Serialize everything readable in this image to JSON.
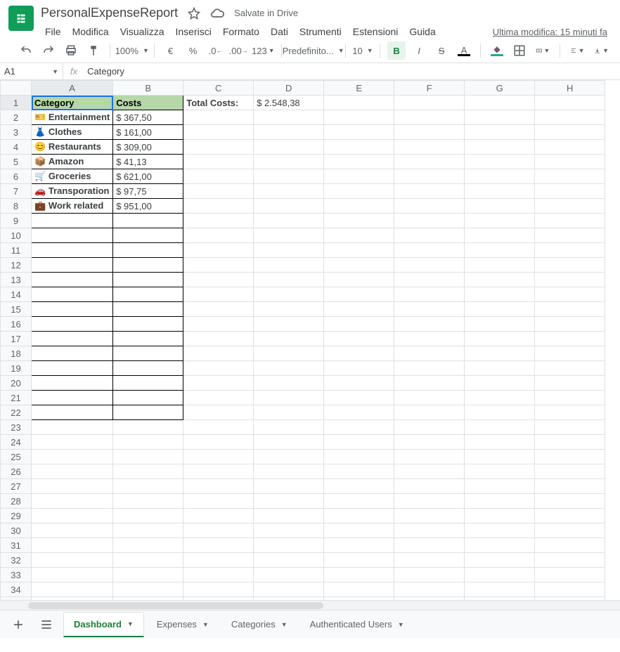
{
  "doc": {
    "title": "PersonalExpenseReport",
    "save_status": "Salvate in Drive",
    "last_edit": "Ultima modifica: 15 minuti fa"
  },
  "menus": [
    "File",
    "Modifica",
    "Visualizza",
    "Inserisci",
    "Formato",
    "Dati",
    "Strumenti",
    "Estensioni",
    "Guida"
  ],
  "toolbar": {
    "zoom": "100%",
    "currency": "€",
    "percent": "%",
    "dec_less": ".0",
    "dec_more": ".00",
    "more_formats": "123",
    "font_name": "Predefinito...",
    "font_size": "10",
    "bold": "B",
    "italic": "I",
    "strike": "S",
    "text_color": "A"
  },
  "fx": {
    "name_box": "A1",
    "formula": "Category"
  },
  "columns": [
    "A",
    "B",
    "C",
    "D",
    "E",
    "F",
    "G",
    "H"
  ],
  "row_count": 35,
  "headers": {
    "A1": "Category",
    "B1": "Costs",
    "C1": "Total Costs:",
    "D1": "$ 2.548,38"
  },
  "rows": [
    {
      "emoji": "🎫",
      "cat": "Entertainment",
      "cost": "$ 367,50"
    },
    {
      "emoji": "👗",
      "cat": "Clothes",
      "cost": "$ 161,00"
    },
    {
      "emoji": "😊",
      "cat": "Restaurants",
      "cost": "$ 309,00"
    },
    {
      "emoji": "📦",
      "cat": "Amazon",
      "cost": "$ 41,13"
    },
    {
      "emoji": "🛒",
      "cat": "Groceries",
      "cost": "$ 621,00"
    },
    {
      "emoji": "🚗",
      "cat": "Transporation",
      "cost": "$ 97,75"
    },
    {
      "emoji": "💼",
      "cat": "Work related",
      "cost": "$ 951,00"
    }
  ],
  "tabs": [
    {
      "label": "Dashboard",
      "active": true
    },
    {
      "label": "Expenses",
      "active": false
    },
    {
      "label": "Categories",
      "active": false
    },
    {
      "label": "Authenticated Users",
      "active": false
    }
  ]
}
